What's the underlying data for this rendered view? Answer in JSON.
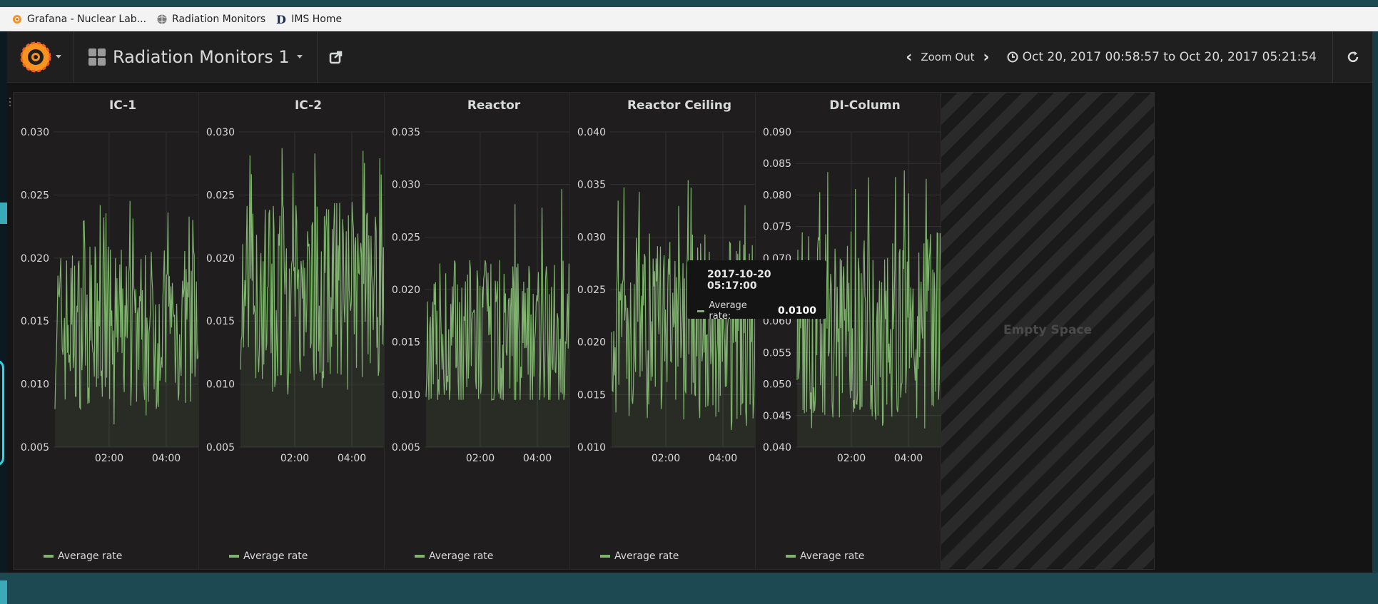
{
  "browser": {
    "bookmarks": [
      {
        "label": "Grafana - Nuclear Lab...",
        "icon": "grafana-icon"
      },
      {
        "label": "Radiation Monitors",
        "icon": "globe-icon"
      },
      {
        "label": "IMS Home",
        "icon": "d-logo-icon"
      }
    ]
  },
  "navbar": {
    "dashboard_title": "Radiation Monitors 1",
    "zoom_out": "Zoom Out",
    "time_range": "Oct 20, 2017 00:58:57 to Oct 20, 2017 05:21:54",
    "icons": [
      "grafana-logo-icon",
      "grid-icon",
      "share-icon",
      "chevron-left-icon",
      "chevron-right-icon",
      "clock-icon",
      "refresh-icon"
    ]
  },
  "colors": {
    "series": "#7eb26d",
    "background": "#141414",
    "panel": "#1f1d1d",
    "text": "#d8d9da",
    "crosshair": "#8b0f0f"
  },
  "panels": [
    {
      "title": "IC-1",
      "legend": "Average rate"
    },
    {
      "title": "IC-2",
      "legend": "Average rate"
    },
    {
      "title": "Reactor",
      "legend": "Average rate"
    },
    {
      "title": "Reactor Ceiling",
      "legend": "Average rate"
    },
    {
      "title": "DI-Column",
      "legend": "Average rate"
    }
  ],
  "empty_panel": {
    "label": "Empty Space"
  },
  "tooltip": {
    "time": "2017-10-20 05:17:00",
    "series": "Average rate:",
    "value": "0.0100"
  },
  "chart_data": [
    {
      "type": "line",
      "title": "IC-1",
      "x_ticks": [
        "02:00",
        "04:00"
      ],
      "y_ticks": [
        "0.005",
        "0.010",
        "0.015",
        "0.020",
        "0.025",
        "0.030"
      ],
      "ylim": [
        0.005,
        0.03
      ],
      "series": [
        {
          "name": "Average rate",
          "mean": 0.0145,
          "min": 0.0068,
          "max": 0.0248
        }
      ],
      "grid": true,
      "legend": "bottom-left"
    },
    {
      "type": "line",
      "title": "IC-2",
      "x_ticks": [
        "02:00",
        "04:00"
      ],
      "y_ticks": [
        "0.005",
        "0.010",
        "0.015",
        "0.020",
        "0.025",
        "0.030"
      ],
      "ylim": [
        0.005,
        0.03
      ],
      "series": [
        {
          "name": "Average rate",
          "mean": 0.0175,
          "min": 0.0088,
          "max": 0.0288
        }
      ],
      "grid": true,
      "legend": "bottom-left"
    },
    {
      "type": "line",
      "title": "Reactor",
      "x_ticks": [
        "02:00",
        "04:00"
      ],
      "y_ticks": [
        "0.005",
        "0.010",
        "0.015",
        "0.020",
        "0.025",
        "0.030",
        "0.035"
      ],
      "ylim": [
        0.005,
        0.035
      ],
      "series": [
        {
          "name": "Average rate",
          "mean": 0.0155,
          "min": 0.0095,
          "max": 0.0306
        }
      ],
      "grid": true,
      "legend": "bottom-left"
    },
    {
      "type": "line",
      "title": "Reactor Ceiling",
      "x_ticks": [
        "02:00",
        "04:00"
      ],
      "y_ticks": [
        "0.010",
        "0.015",
        "0.020",
        "0.025",
        "0.030",
        "0.035",
        "0.040"
      ],
      "ylim": [
        0.01,
        0.04
      ],
      "series": [
        {
          "name": "Average rate",
          "mean": 0.0215,
          "min": 0.0108,
          "max": 0.0355
        }
      ],
      "grid": true,
      "legend": "bottom-left"
    },
    {
      "type": "line",
      "title": "DI-Column",
      "x_ticks": [
        "02:00",
        "04:00"
      ],
      "y_ticks": [
        "0.040",
        "0.045",
        "0.050",
        "0.055",
        "0.060",
        "0.065",
        "0.070",
        "0.075",
        "0.080",
        "0.085",
        "0.090"
      ],
      "ylim": [
        0.04,
        0.09
      ],
      "series": [
        {
          "name": "Average rate",
          "mean": 0.0595,
          "min": 0.0428,
          "max": 0.0842
        }
      ],
      "grid": true,
      "legend": "bottom-left"
    }
  ]
}
